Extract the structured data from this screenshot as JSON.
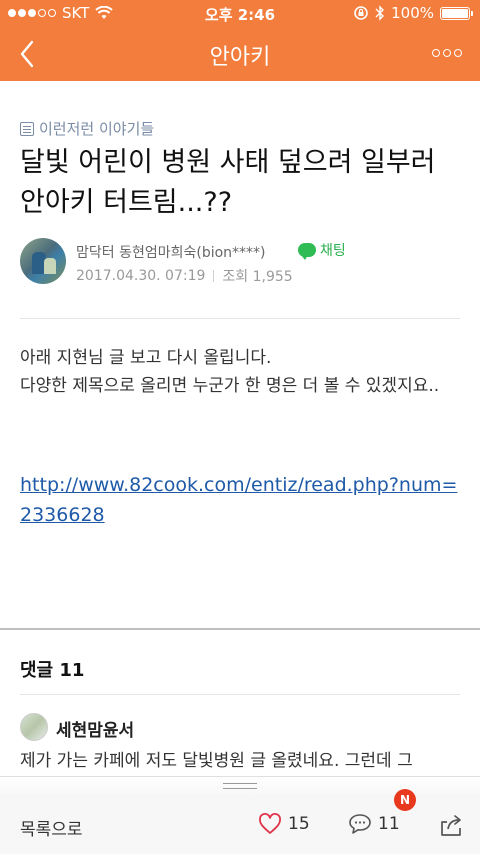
{
  "status_bar": {
    "carrier": "SKT",
    "time": "오후 2:46",
    "battery": "100%",
    "signal_dots_filled": 3,
    "signal_dots_total": 5
  },
  "nav": {
    "title": "안아키",
    "back_icon": "chevron-left-icon",
    "more_icon": "more-horizontal-icon"
  },
  "article": {
    "category": "이런저런 이야기들",
    "title": "달빛 어린이 병원 사태 덮으려 일부러 안아키 터트림...??",
    "author": "맘닥터 동현엄마희숙(bion****)",
    "chat_label": "채팅",
    "date": "2017.04.30. 07:19",
    "views": "조회 1,955",
    "body": [
      "아래 지현님 글 보고 다시 올립니다.",
      "다양한 제목으로 올리면 누군가 한 명은 더 볼 수 있겠지요.."
    ],
    "link": "http://www.82cook.com/entiz/read.php?num=2336628"
  },
  "comments": {
    "title": "댓글 11",
    "first": {
      "author": "세현맘윤서",
      "text": "제가 가는 카페에 저도 달빛병원 글 올렸네요. 그런데 그"
    }
  },
  "toolbar": {
    "list_label": "목록으로",
    "likes": "15",
    "comments": "11",
    "badge": "N"
  },
  "colors": {
    "brand": "#f27d3c",
    "chat_green": "#27b04d",
    "link": "#1e5aa8",
    "badge": "#e8391f"
  }
}
